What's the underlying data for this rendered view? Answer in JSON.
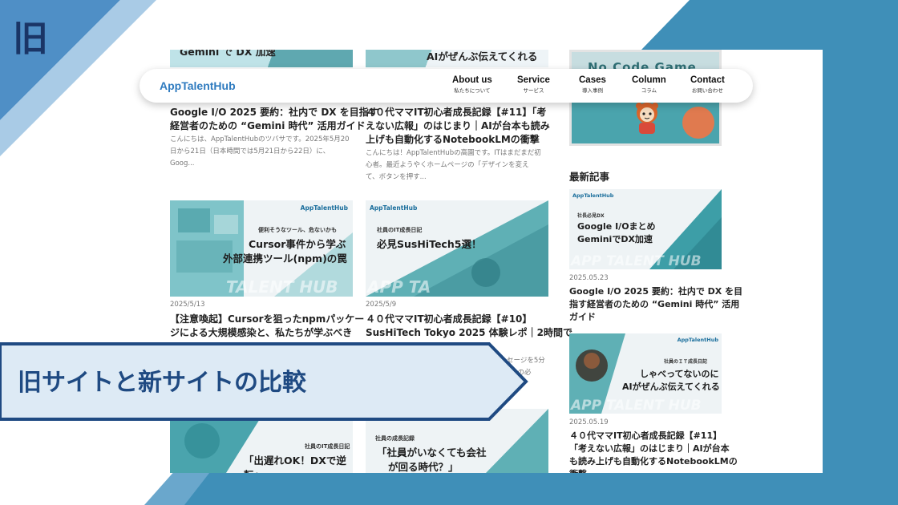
{
  "old_label": "旧",
  "banner_text": "旧サイトと新サイトの比較",
  "nav": {
    "logo": "AppTalentHub",
    "items": [
      {
        "en": "About us",
        "jp": "私たちについて"
      },
      {
        "en": "Service",
        "jp": "サービス"
      },
      {
        "en": "Cases",
        "jp": "導入事例"
      },
      {
        "en": "Column",
        "jp": "コラム"
      },
      {
        "en": "Contact",
        "jp": "お問い合わせ"
      }
    ]
  },
  "top_partial": {
    "left": "Gemini で DX 加速",
    "mid": "AIがぜんぶ伝えてくれる"
  },
  "articles": [
    {
      "title": "Google I/O 2025 要約：社内で DX を目指す経営者のための “Gemini 時代” 活用ガイド",
      "title_line1": "Google I/O 2025 要約：社内で DX を目指す",
      "title_line2": "経営者のための “Gemini 時代” 活用ガイド",
      "excerpt_line1": "こんにちは、AppTalentHubのツバサです。2025年5月20",
      "excerpt_line2": "日から21日（日本時間では5月21日から22日）に、",
      "excerpt_line3": "Goog..."
    },
    {
      "title_line1": "４０代ママIT初心者成長記録【#11】「考",
      "title_line2": "えない広報」のはじまり｜AIが台本も読み",
      "title_line3": "上げも自動化するNotebookLMの衝撃",
      "excerpt_line1": "こんにちは！AppTalentHubの高園です。ITはまだまだ初",
      "excerpt_line2": "心者。最近ようやくホームページの「デザインを変え",
      "excerpt_line3": "て、ボタンを押す..."
    },
    {
      "thumb_brand": "AppTalentHub",
      "thumb_sub": "便利そうなツール、危ないかも",
      "thumb_line1": "Cursor事件から学ぶ",
      "thumb_line2": "外部連携ツール(npm)の罠",
      "thumb_wm": "TALENT HUB",
      "date": "2025/5/13",
      "title_line1": "【注意喚起】Cursorを狙ったnpmパッケー",
      "title_line2": "ジによる大規模感染と、私たちが学ぶべき"
    },
    {
      "thumb_brand": "AppTalentHub",
      "thumb_sub": "社員のIT成長日記",
      "thumb_line1": "必見SusHiTech5選！",
      "thumb_wm": "APP TA",
      "date": "2025/5/9",
      "title_line1": "４０代ママIT初心者成長記録【#10】",
      "title_line2": "SusHiTech Tokyo 2025 体験レポ｜2時間で",
      "excerpt_tail1": "セージを5分",
      "excerpt_tail2": "25 の必"
    },
    {
      "thumb_sub": "社員のIT成長日記",
      "thumb_line1": "「出遅れOK！DXで逆転」"
    },
    {
      "thumb_sub": "社員の成長記録",
      "thumb_line1": "「社員がいなくても会社",
      "thumb_line2": "が回る時代？」"
    }
  ],
  "sidebar": {
    "top_thumb_text": "No Code Game",
    "heading": "最新記事",
    "posts": [
      {
        "brand": "AppTalentHub",
        "sub": "社長必見DX",
        "line1": "Google I/Oまとめ",
        "line2": "GeminiでDX加速",
        "wm": "APP TALENT HUB",
        "date": "2025.05.23",
        "title_line1": "Google I/O 2025 要約：社内で DX を目",
        "title_line2": "指す経営者のための “Gemini 時代” 活用",
        "title_line3": "ガイド"
      },
      {
        "brand": "AppTalentHub",
        "sub": "社員のＩＴ成長日記",
        "line1": "しゃべってないのに",
        "line2": "AIがぜんぶ伝えてくれる",
        "wm": "APP TALENT HUB",
        "date": "2025.05.19",
        "title_line1": "４０代ママIT初心者成長記録【#11】",
        "title_line2": "「考えない広報」のはじまり｜AIが台本",
        "title_line3": "も読み上げも自動化するNotebookLMの",
        "title_line4": "衝撃"
      }
    ]
  },
  "colors": {
    "accent_blue": "#3c8fc0",
    "dark_navy": "#1a3566",
    "banner_fill": "#ddeaf5",
    "banner_border": "#1f4a82",
    "thumb_teal": "#7fc4c9"
  }
}
